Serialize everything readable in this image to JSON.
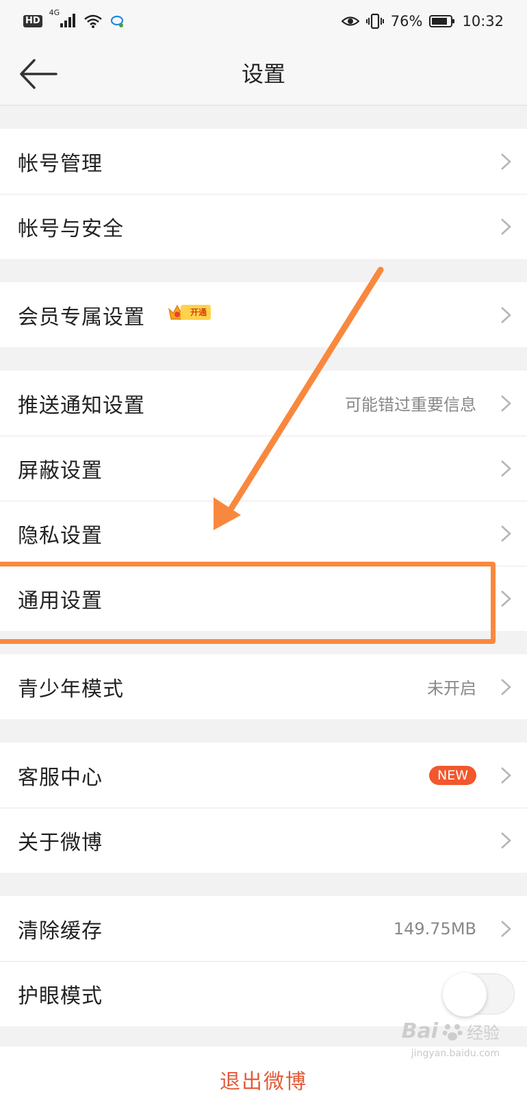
{
  "status_bar": {
    "hd": "HD",
    "network": "4G",
    "battery_percent": "76%",
    "time": "10:32"
  },
  "nav": {
    "title": "设置"
  },
  "rows": {
    "account_manage": "帐号管理",
    "account_security": "帐号与安全",
    "vip_settings": "会员专属设置",
    "vip_tag": "开通",
    "push_settings": "推送通知设置",
    "push_value": "可能错过重要信息",
    "block_settings": "屏蔽设置",
    "privacy_settings": "隐私设置",
    "general_settings": "通用设置",
    "youth_mode": "青少年模式",
    "youth_value": "未开启",
    "customer_service": "客服中心",
    "new_badge": "NEW",
    "about_weibo": "关于微博",
    "clear_cache": "清除缓存",
    "cache_size": "149.75MB",
    "eye_mode": "护眼模式",
    "eye_mode_on": false,
    "logout": "退出微博"
  },
  "watermark": {
    "brand": "Bai",
    "brand_cn": "经验",
    "url": "jingyan.baidu.com"
  },
  "colors": {
    "annotation": "#f9883e",
    "badge": "#f2572d",
    "logout": "#e25b3a"
  }
}
